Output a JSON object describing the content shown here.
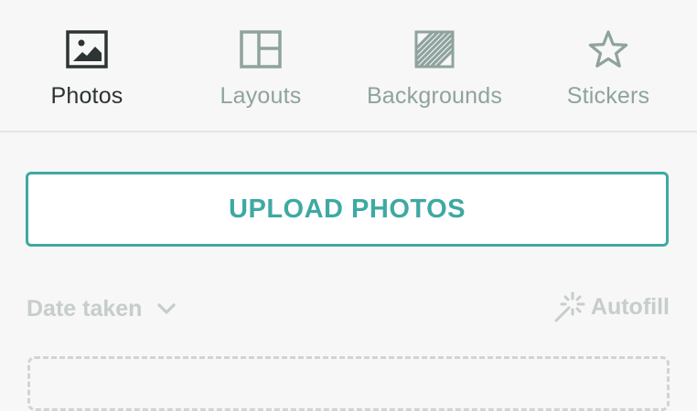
{
  "tabs": [
    {
      "label": "Photos",
      "icon": "image-icon",
      "active": true
    },
    {
      "label": "Layouts",
      "icon": "layout-icon",
      "active": false
    },
    {
      "label": "Backgrounds",
      "icon": "pattern-icon",
      "active": false
    },
    {
      "label": "Stickers",
      "icon": "star-icon",
      "active": false
    }
  ],
  "upload": {
    "label": "UPLOAD PHOTOS"
  },
  "sort": {
    "label": "Date taken"
  },
  "autofill": {
    "label": "Autofill"
  },
  "colors": {
    "accent": "#3ea9a3",
    "inactive": "#8fa39e",
    "active_text": "#2d3433",
    "muted": "#c6cdcb"
  }
}
